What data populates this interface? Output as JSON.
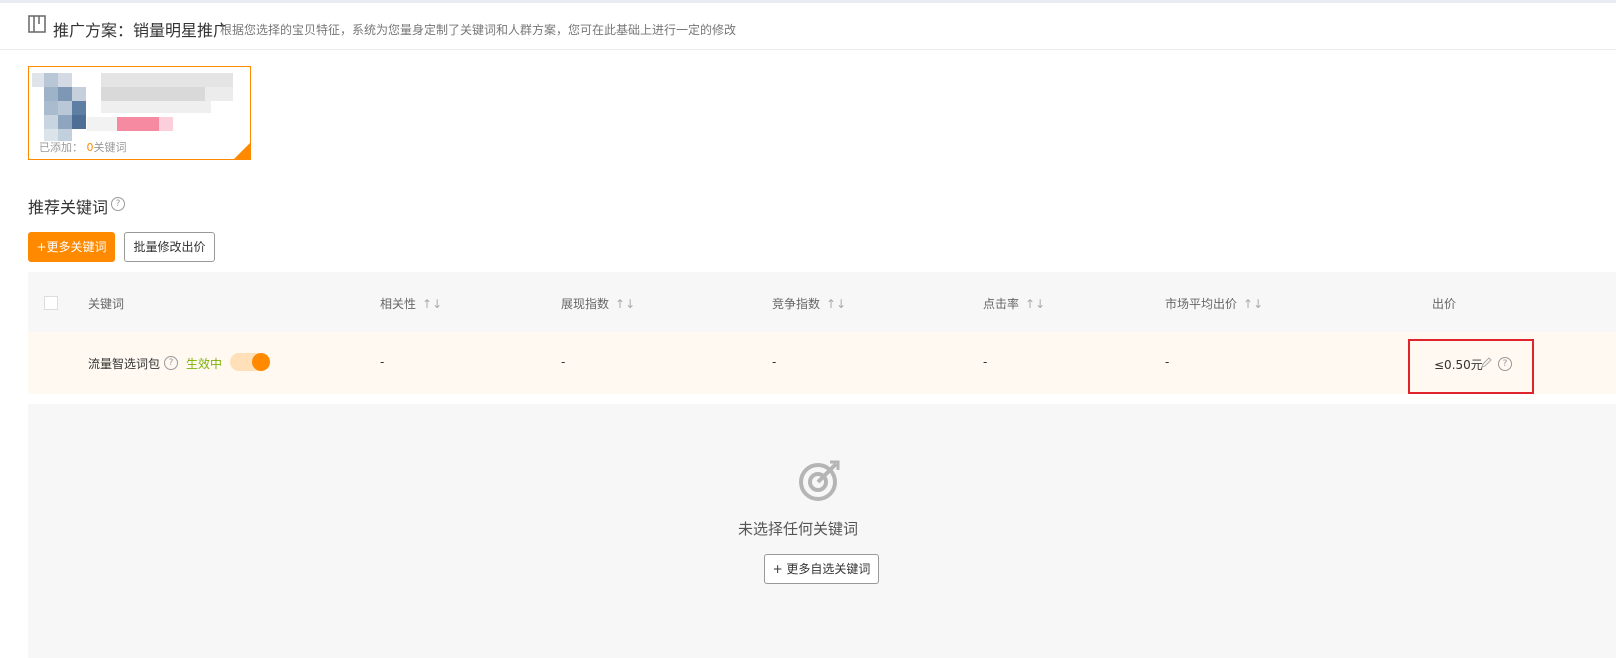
{
  "header": {
    "title": "推广方案：销量明星推广",
    "description": "根据您选择的宝贝特征，系统为您量身定制了关键词和人群方案，您可在此基础上进行一定的修改"
  },
  "product_card": {
    "added_label": "已添加：",
    "added_count": "0",
    "added_unit": "关键词"
  },
  "keywords_section": {
    "title": "推荐关键词",
    "help": "?",
    "add_more_label": "+更多关键词",
    "batch_edit_label": "批量修改出价"
  },
  "table": {
    "columns": {
      "keyword": "关键词",
      "relevance": "相关性",
      "impression": "展现指数",
      "competition": "竞争指数",
      "ctr": "点击率",
      "market_bid": "市场平均出价",
      "bid": "出价"
    },
    "sort_symbol": "↑↓",
    "row": {
      "keyword": "流量智选词包",
      "status": "生效中",
      "relevance": "-",
      "impression": "-",
      "competition": "-",
      "ctr": "-",
      "market_bid": "-",
      "bid": "≤0.50元",
      "toggle_on": true
    }
  },
  "empty_state": {
    "message": "未选择任何关键词",
    "button_label": "+ 更多自选关键词"
  },
  "colors": {
    "accent": "#ff8a00",
    "status_green": "#7cb305",
    "highlight_red": "#e0242b"
  }
}
